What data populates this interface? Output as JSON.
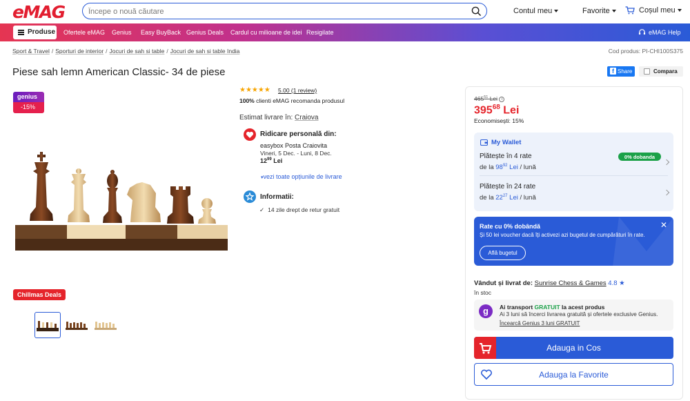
{
  "header": {
    "logo": "eMAG",
    "search_placeholder": "Începe o nouă căutare",
    "account": "Contul meu",
    "favorites": "Favorite",
    "cart": "Coșul meu"
  },
  "nav": {
    "produse": "Produse",
    "items": [
      "Ofertele eMAG",
      "Genius",
      "Easy BuyBack",
      "Genius Deals",
      "Cardul cu milioane de idei",
      "Resigilate"
    ],
    "help": "eMAG Help"
  },
  "breadcrumb": [
    "Sport & Travel",
    "Sporturi de interior",
    "Jocuri de sah si table",
    "Jocuri de sah si table India"
  ],
  "product_code": "Cod produs: PI-CHI100S375",
  "title": "Piese sah lemn American Classic- 34 de piese",
  "share": "Share",
  "compare": "Compara",
  "badge": {
    "top": "genius",
    "bottom": "-15%"
  },
  "chillmas": "Chillmas Deals",
  "rating": {
    "stars": 5,
    "text": "5.00 (1 review)",
    "recommend_bold": "100%",
    "recommend_text": " clienti eMAG recomanda produsul"
  },
  "delivery": {
    "estimate_label": "Estimat livrare în: ",
    "city": "Craiova",
    "pickup_title": "Ridicare personală din:",
    "pickup_place": "easybox Posta Craiovita",
    "pickup_dates": "Vineri, 5 Dec. - Luni, 8 Dec.",
    "pickup_price_int": "12",
    "pickup_price_dec": "99",
    "pickup_currency": "Lei",
    "all_options": "vezi toate opțiunile de livrare",
    "info_title": "Informatii:",
    "return": "14 zile drept de retur gratuit"
  },
  "price": {
    "old_int": "465",
    "old_dec": "51",
    "old_currency": "Lei",
    "new_int": "395",
    "new_dec": "68",
    "currency": "Lei",
    "savings": "Economisești: 15%"
  },
  "wallet": {
    "title": "My Wallet",
    "plan1_title": "Plătește în 4 rate",
    "plan1_badge": "0% dobanda",
    "plan1_prefix": "de la ",
    "plan1_int": "98",
    "plan1_dec": "92",
    "plan1_currency": "Lei",
    "plan1_suffix": " / lună",
    "plan2_title": "Plătește în 24 rate",
    "plan2_prefix": "de la ",
    "plan2_int": "22",
    "plan2_dec": "27",
    "plan2_currency": "Lei",
    "plan2_suffix": " / lună"
  },
  "promo": {
    "title": "Rate cu 0% dobândă",
    "text": "Și 50 lei voucher dacă îți activezi azi bugetul de cumpărături în rate.",
    "button": "Află bugetul"
  },
  "seller": {
    "label": "Vândut și livrat de: ",
    "name": "Sunrise Chess & Games",
    "rating": "4.8",
    "stock": "în stoc"
  },
  "genius_box": {
    "pre": "Ai transport ",
    "free": "GRATUIT",
    "post": " la acest produs",
    "line2": "Ai 3 luni să încerci livrarea gratuită și ofertele exclusive Genius.",
    "link": "Încearcă Genius 3 luni GRATUIT"
  },
  "buttons": {
    "add_cart": "Adauga in Cos",
    "add_fav": "Adauga la Favorite"
  },
  "colors": {
    "brand": "#e21e30",
    "accent": "#2a5bd7",
    "green": "#1ba148"
  }
}
